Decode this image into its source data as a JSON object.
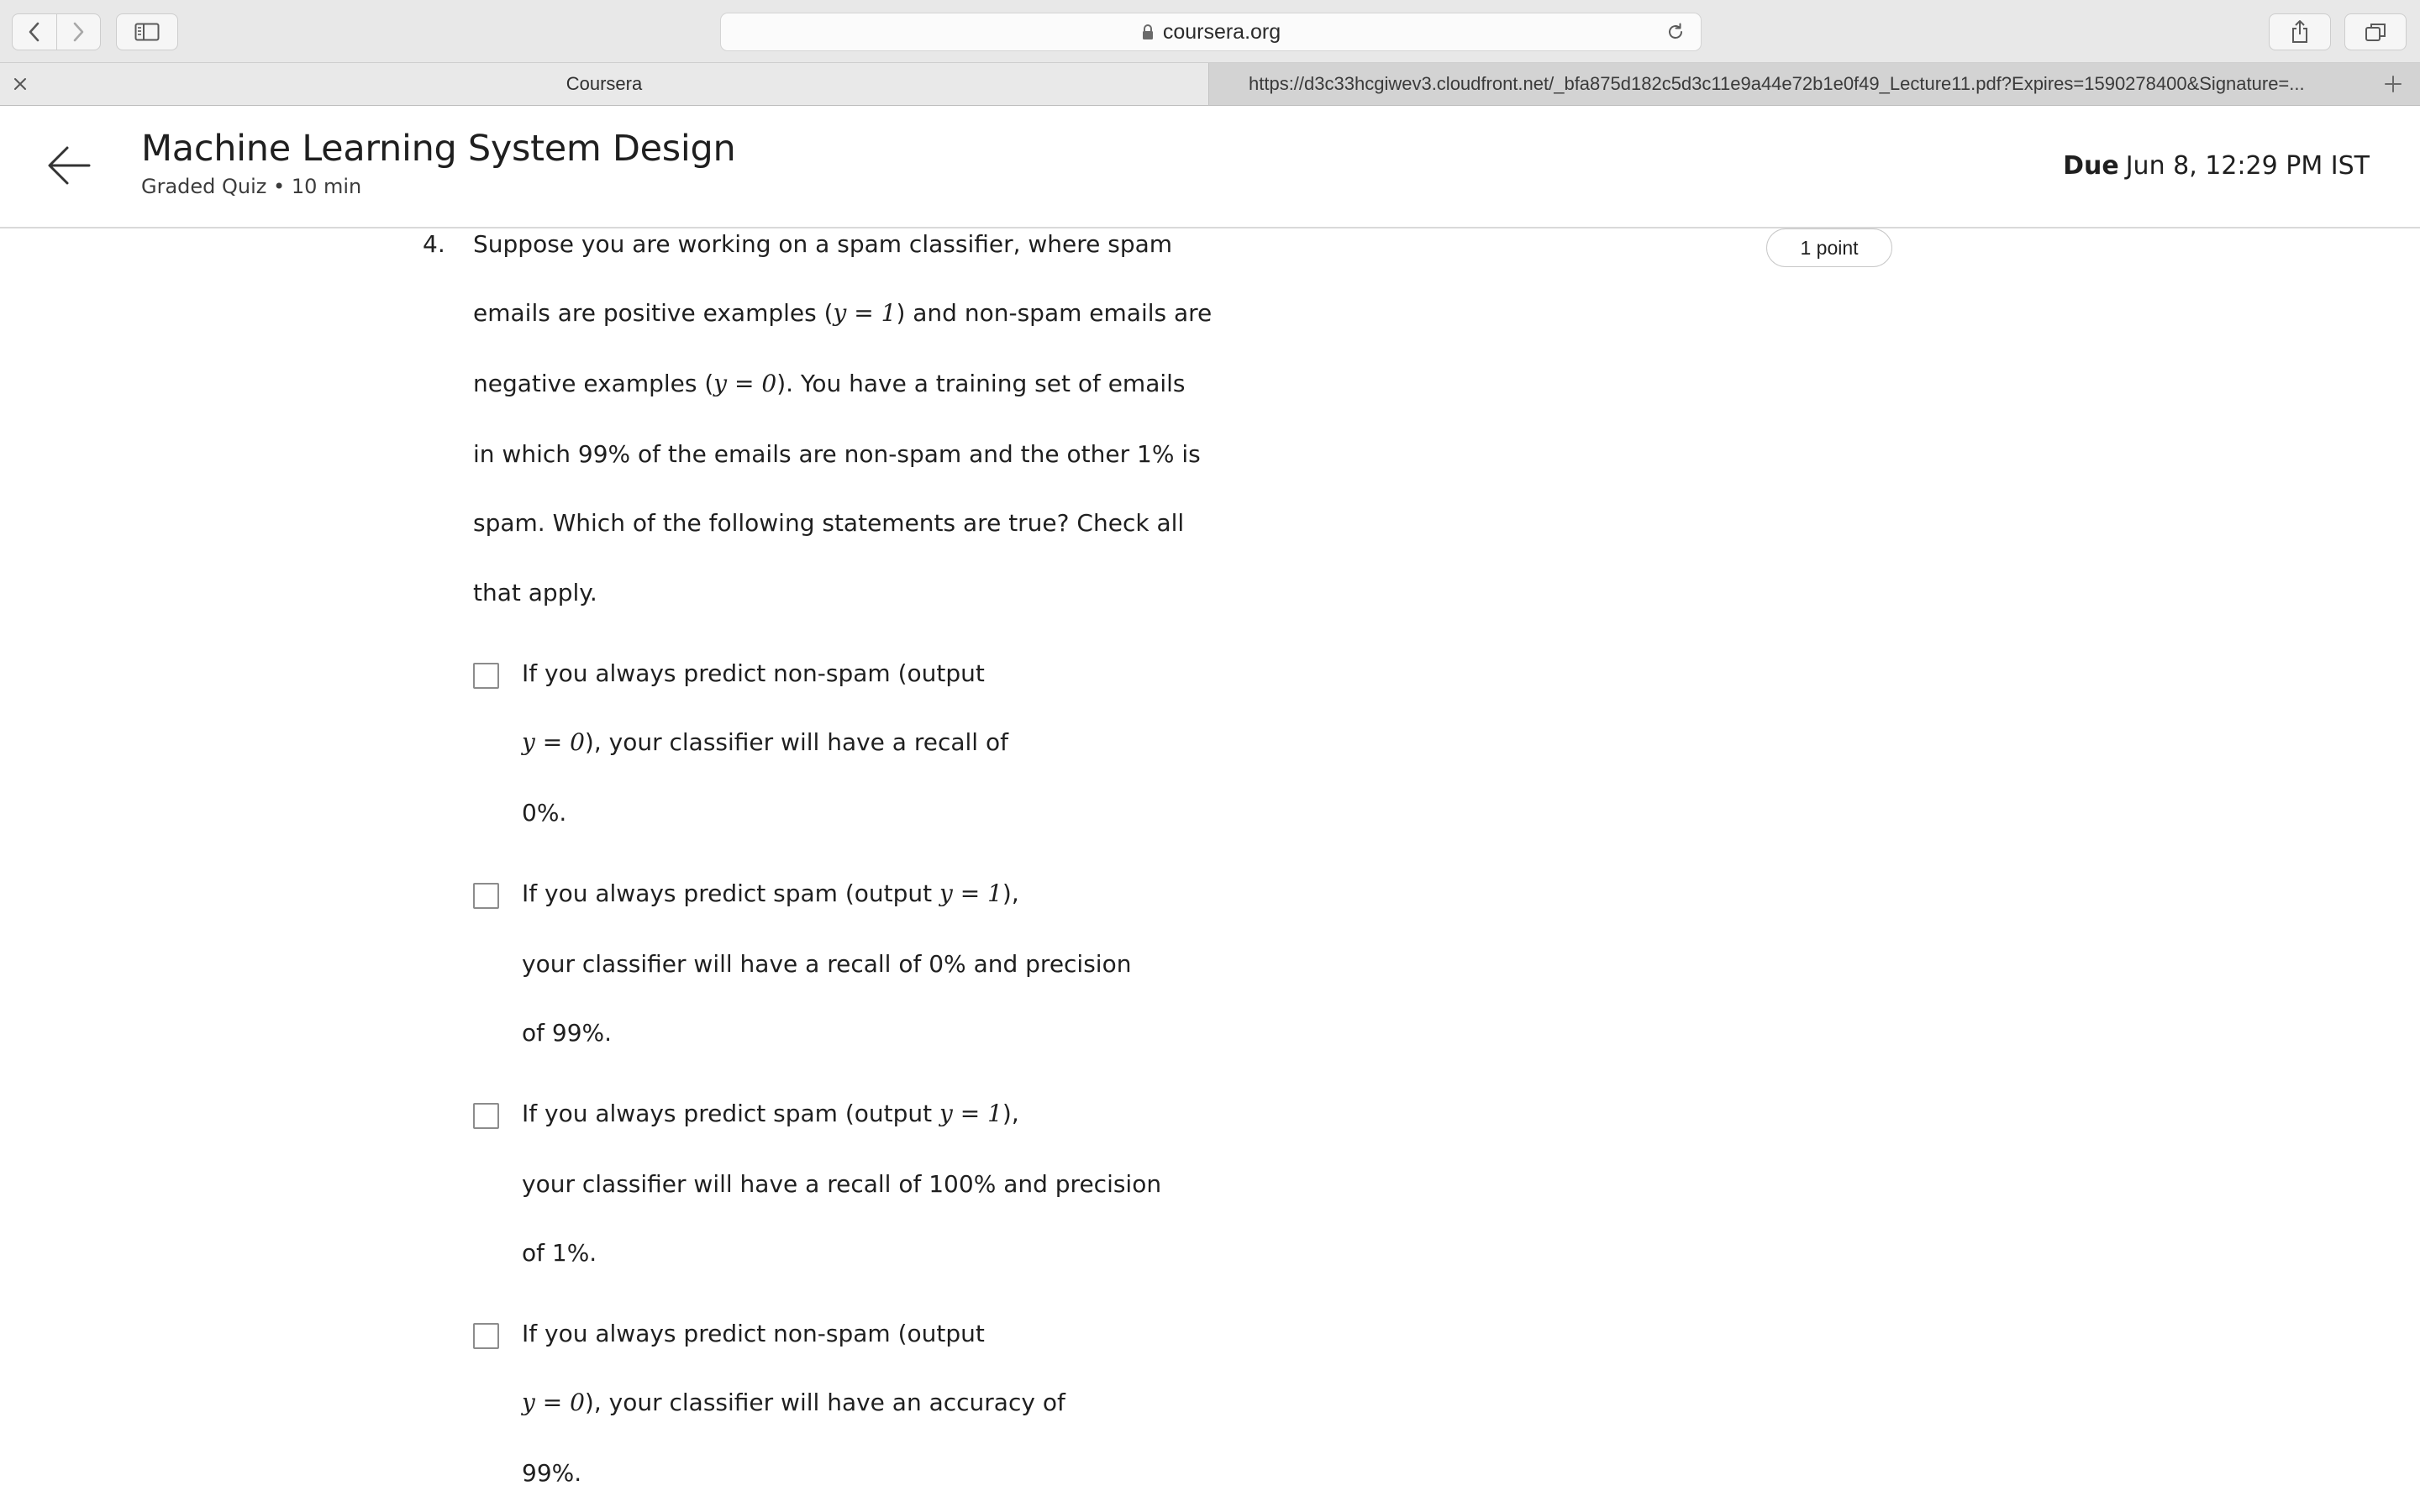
{
  "browser": {
    "address": "coursera.org",
    "tabs": [
      {
        "title": "Coursera",
        "active": true
      },
      {
        "title": "https://d3c33hcgiwev3.cloudfront.net/_bfa875d182c5d3c11e9a44e72b1e0f49_Lecture11.pdf?Expires=1590278400&Signature=...",
        "active": false
      }
    ],
    "icons": [
      "back-icon",
      "forward-icon",
      "sidebar-icon",
      "lock-icon",
      "reload-icon",
      "share-icon",
      "tabs-overview-icon",
      "close-tab-icon",
      "new-tab-icon"
    ]
  },
  "header": {
    "title": "Machine Learning System Design",
    "subtitle": "Graded Quiz • 10 min",
    "due_label": "Due",
    "due_value": "Jun 8, 12:29 PM IST"
  },
  "question": {
    "number": "4.",
    "points": "1 point",
    "lines": {
      "l1": "Suppose you are working on a spam classifier, where spam",
      "l2a": "emails are positive examples (",
      "l2b": ") and non-spam emails are",
      "l3a": "negative examples (",
      "l3b": "). You have a training set of emails",
      "l4": "in which 99% of the emails are non-spam and the other 1% is",
      "l5": "spam. Which of the following statements are true? Check all",
      "l6": "that apply."
    },
    "options": [
      {
        "checked": false,
        "line1": "If you always predict non-spam (output",
        "line2_suffix": "), your classifier will have a recall of",
        "line3": "0%."
      },
      {
        "checked": false,
        "line1_prefix": "If you always predict spam (output ",
        "line1_suffix": "),",
        "line2": "your classifier will have a recall of 0% and precision",
        "line3": "of 99%."
      },
      {
        "checked": false,
        "line1_prefix": "If you always predict spam (output ",
        "line1_suffix": "),",
        "line2": "your classifier will have a recall of 100% and precision",
        "line3": "of 1%."
      },
      {
        "checked": false,
        "line1": "If you always predict non-spam (output",
        "line2_suffix": "), your classifier will have an accuracy of",
        "line3": "99%."
      }
    ]
  },
  "math": {
    "y_eq_1": "y = 1",
    "y_eq_0": "y = 0"
  }
}
